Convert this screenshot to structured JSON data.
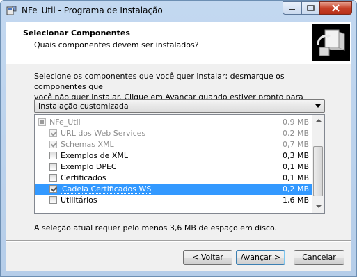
{
  "window": {
    "title": "NFe_Util - Programa de Instalação"
  },
  "header": {
    "title": "Selecionar Componentes",
    "subtitle": "Quais componentes devem ser instalados?"
  },
  "description": {
    "line1": "Selecione os componentes que você quer instalar; desmarque os componentes que",
    "line2": "você não quer instalar. Clique em Avançar quando estiver pronto para continuar."
  },
  "install_type": {
    "selected": "Instalação customizada"
  },
  "components": [
    {
      "label": "NFe_Util",
      "size": "0,9 MB",
      "state": "partial",
      "disabled": true,
      "selected": false
    },
    {
      "label": "URL dos Web Services",
      "size": "0,2 MB",
      "state": "checked",
      "disabled": true,
      "selected": false
    },
    {
      "label": "Schemas XML",
      "size": "0,7 MB",
      "state": "checked",
      "disabled": true,
      "selected": false
    },
    {
      "label": "Exemplos de XML",
      "size": "0,3 MB",
      "state": "unchecked",
      "disabled": false,
      "selected": false
    },
    {
      "label": "Exemplo DPEC",
      "size": "0,1 MB",
      "state": "unchecked",
      "disabled": false,
      "selected": false
    },
    {
      "label": "Certificados",
      "size": "0,1 MB",
      "state": "unchecked",
      "disabled": false,
      "selected": false
    },
    {
      "label": "Cadeia Certificados WS",
      "size": "0,2 MB",
      "state": "checked",
      "disabled": false,
      "selected": true
    },
    {
      "label": "Utilitários",
      "size": "1,6 MB",
      "state": "unchecked",
      "disabled": false,
      "selected": false
    }
  ],
  "space_required": "A seleção atual requer pelo menos 3,6 MB de espaço em disco.",
  "buttons": {
    "back": "< Voltar",
    "next": "Avançar >",
    "cancel": "Cancelar"
  },
  "colors": {
    "selection": "#3399ff",
    "close_button": "#c7422a"
  },
  "icons": {
    "app": "installer-icon",
    "wizard": "computer-install-icon"
  }
}
